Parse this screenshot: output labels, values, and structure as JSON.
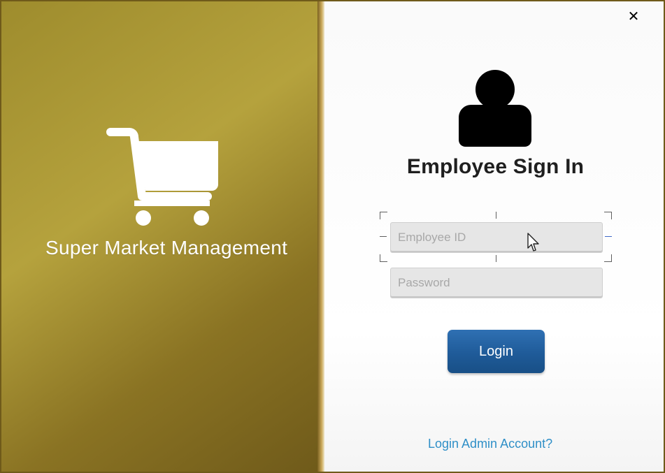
{
  "window": {
    "close_label": "✕"
  },
  "left_panel": {
    "icon": "shopping-cart-icon",
    "title": "Super Market Management"
  },
  "right_panel": {
    "user_icon": "user-icon",
    "heading": "Employee Sign In",
    "employee_field": {
      "placeholder": "Employee ID",
      "value": ""
    },
    "password_field": {
      "placeholder": "Password",
      "value": ""
    },
    "login_button_label": "Login",
    "admin_link_label": "Login Admin Account?"
  },
  "colors": {
    "left_panel_gold": "#9e8c2d",
    "button_blue": "#1f5b99",
    "link_blue": "#2f8fc7",
    "field_gray": "#e6e6e6"
  }
}
